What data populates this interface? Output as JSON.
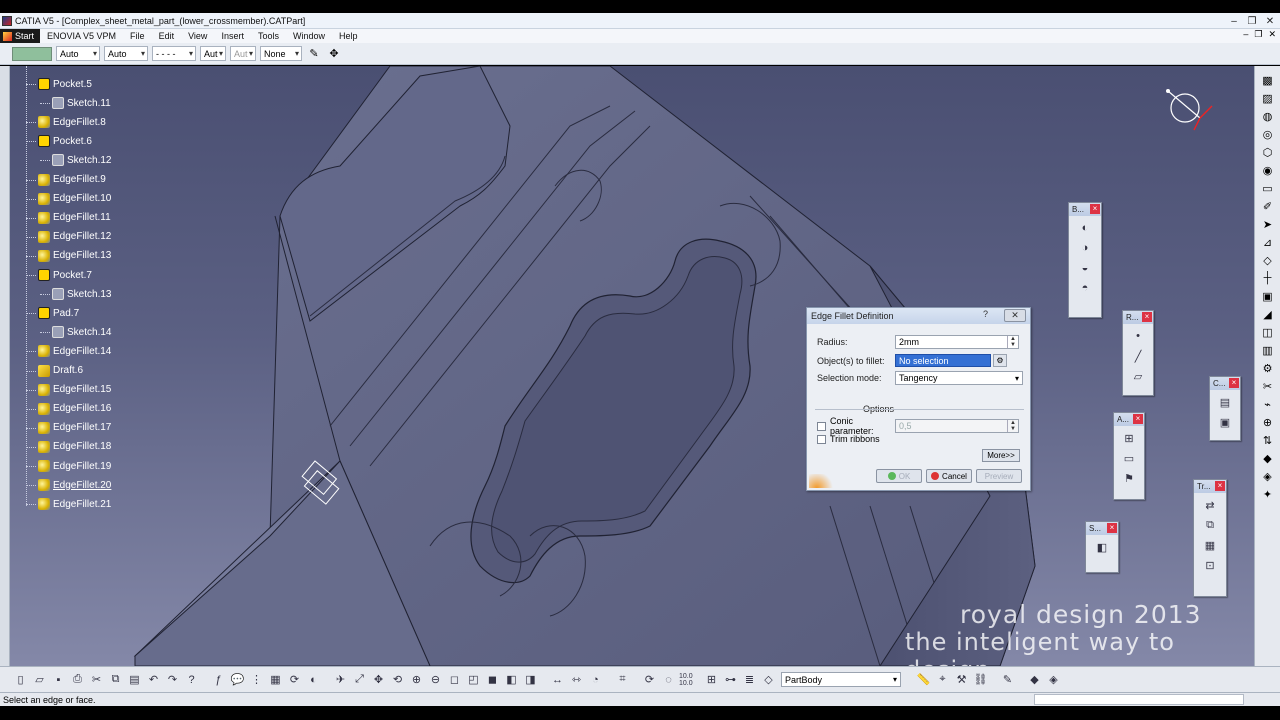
{
  "window": {
    "title": "CATIA V5 - [Complex_sheet_metal_part_(lower_crossmember).CATPart]"
  },
  "menu": {
    "items": [
      "Start",
      "ENOVIA V5 VPM",
      "File",
      "Edit",
      "View",
      "Insert",
      "Tools",
      "Window",
      "Help"
    ]
  },
  "properties_toolbar": {
    "linetype": "Auto",
    "thickness": "Auto",
    "linestyle": "- - - -",
    "layer_a": "Aut",
    "layer_b": "Aut",
    "layer_name": "None"
  },
  "tree": {
    "nodes": [
      {
        "label": "Pocket.5",
        "icon": "pocket-icon",
        "indent": 1
      },
      {
        "label": "Sketch.11",
        "icon": "sketch-icon",
        "indent": 2
      },
      {
        "label": "EdgeFillet.8",
        "icon": "fillet-icon",
        "indent": 1
      },
      {
        "label": "Pocket.6",
        "icon": "pocket-icon",
        "indent": 1
      },
      {
        "label": "Sketch.12",
        "icon": "sketch-icon",
        "indent": 2
      },
      {
        "label": "EdgeFillet.9",
        "icon": "fillet-icon",
        "indent": 1
      },
      {
        "label": "EdgeFillet.10",
        "icon": "fillet-icon",
        "indent": 1
      },
      {
        "label": "EdgeFillet.11",
        "icon": "fillet-icon",
        "indent": 1
      },
      {
        "label": "EdgeFillet.12",
        "icon": "fillet-icon",
        "indent": 1
      },
      {
        "label": "EdgeFillet.13",
        "icon": "fillet-icon",
        "indent": 1
      },
      {
        "label": "Pocket.7",
        "icon": "pocket-icon",
        "indent": 1
      },
      {
        "label": "Sketch.13",
        "icon": "sketch-icon",
        "indent": 2
      },
      {
        "label": "Pad.7",
        "icon": "pad-icon",
        "indent": 1
      },
      {
        "label": "Sketch.14",
        "icon": "sketch-icon",
        "indent": 2
      },
      {
        "label": "EdgeFillet.14",
        "icon": "fillet-icon",
        "indent": 1
      },
      {
        "label": "Draft.6",
        "icon": "draft-icon",
        "indent": 1
      },
      {
        "label": "EdgeFillet.15",
        "icon": "fillet-icon",
        "indent": 1
      },
      {
        "label": "EdgeFillet.16",
        "icon": "fillet-icon",
        "indent": 1
      },
      {
        "label": "EdgeFillet.17",
        "icon": "fillet-icon",
        "indent": 1
      },
      {
        "label": "EdgeFillet.18",
        "icon": "fillet-icon",
        "indent": 1
      },
      {
        "label": "EdgeFillet.19",
        "icon": "fillet-icon",
        "indent": 1
      },
      {
        "label": "EdgeFillet.20",
        "icon": "fillet-icon",
        "indent": 1
      },
      {
        "label": "EdgeFillet.21",
        "icon": "fillet-icon",
        "indent": 1
      }
    ]
  },
  "dialog": {
    "title": "Edge Fillet Definition",
    "help": "?",
    "radius_label": "Radius:",
    "radius_value": "2mm",
    "objects_label": "Object(s) to fillet:",
    "objects_value": "No selection",
    "mode_label": "Selection mode:",
    "mode_value": "Tangency",
    "options_label": "Options",
    "conic_label": "Conic parameter:",
    "conic_value": "0,5",
    "trim_label": "Trim ribbons",
    "more_label": "More>>",
    "ok_label": "OK",
    "cancel_label": "Cancel",
    "preview_label": "Preview"
  },
  "floating_toolbars": {
    "b_title": "B...",
    "r_title": "R...",
    "c_title": "C...",
    "a_title": "A...",
    "s_title": "S...",
    "tr_title": "Tr..."
  },
  "watermark": {
    "line1": "royal design 2013",
    "line2": "the inteligent way to design"
  },
  "bottom_toolbar": {
    "body_select": "PartBody",
    "scale_label": "10.0 10.0"
  },
  "status": {
    "message": "Select an edge or face."
  },
  "colors": {
    "viewport_top": "#4a4f72",
    "viewport_bottom": "#8488a8",
    "part_face": "#5f6482",
    "selection_blue": "#3470d4"
  }
}
